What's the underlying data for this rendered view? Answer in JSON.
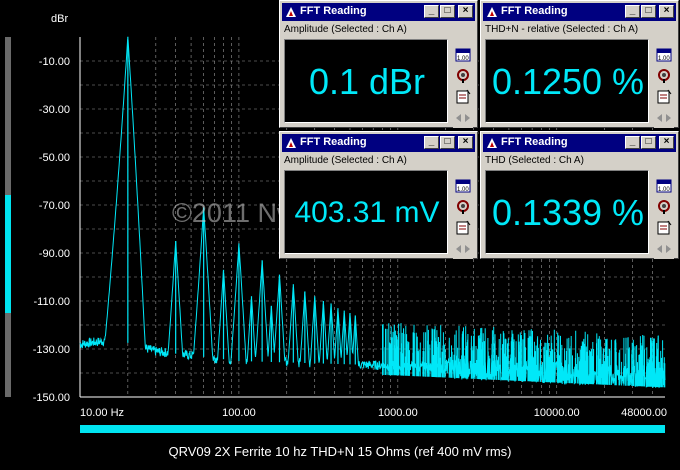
{
  "chart_data": {
    "type": "line",
    "ylabel": "dBr",
    "ylim": [
      -150,
      0
    ],
    "xscale": "log",
    "xlim": [
      10,
      48000
    ],
    "y_ticks": [
      "-10.00",
      "-30.00",
      "-50.00",
      "-70.00",
      "-90.00",
      "-110.00",
      "-130.00",
      "-150.00"
    ],
    "x_ticks": [
      "10.00 Hz",
      "100.00",
      "1000.00",
      "10000.00",
      "48000.00"
    ],
    "grid": true,
    "series": [
      {
        "color": "#00e8f8",
        "peaks": [
          {
            "x": 20,
            "y": 0.1
          },
          {
            "x": 40,
            "y": -85
          },
          {
            "x": 60,
            "y": -71
          },
          {
            "x": 80,
            "y": -97
          },
          {
            "x": 100,
            "y": -86
          },
          {
            "x": 120,
            "y": -108
          },
          {
            "x": 140,
            "y": -93
          },
          {
            "x": 160,
            "y": -112
          },
          {
            "x": 180,
            "y": -99
          },
          {
            "x": 220,
            "y": -103
          },
          {
            "x": 260,
            "y": -106
          },
          {
            "x": 300,
            "y": -108
          },
          {
            "x": 340,
            "y": -110
          },
          {
            "x": 380,
            "y": -111
          },
          {
            "x": 420,
            "y": -113
          },
          {
            "x": 460,
            "y": -114
          },
          {
            "x": 500,
            "y": -115
          },
          {
            "x": 540,
            "y": -116
          }
        ],
        "noise_floor": [
          {
            "x": 10,
            "y": -128
          },
          {
            "x": 17,
            "y": -126
          },
          {
            "x": 30,
            "y": -131
          },
          {
            "x": 100,
            "y": -135
          },
          {
            "x": 1000,
            "y": -137
          },
          {
            "x": 10000,
            "y": -140
          },
          {
            "x": 48000,
            "y": -142
          }
        ]
      }
    ]
  },
  "watermark": "©2011 NwAvGuy.com",
  "caption": "QRV09 2X Ferrite 10 hz THD+N 15 Ohms (ref 400 mV rms)",
  "windows": [
    {
      "title": "FFT Reading",
      "subtitle": "Amplitude (Selected : Ch A)",
      "value": "0.1 dBr"
    },
    {
      "title": "FFT Reading",
      "subtitle": "THD+N - relative (Selected : Ch A)",
      "value": "0.1250 %"
    },
    {
      "title": "FFT Reading",
      "subtitle": "Amplitude (Selected : Ch A)",
      "value": "403.31 mV"
    },
    {
      "title": "FFT Reading",
      "subtitle": "THD (Selected : Ch A)",
      "value": "0.1339 %"
    }
  ],
  "window_buttons": {
    "minimize": "_",
    "maximize": "□",
    "close": "×"
  },
  "side_buttons": [
    "meter-scale-icon",
    "settings-gear-icon",
    "notepad-icon",
    "arrows-icon"
  ],
  "colors": {
    "trace": "#00e8f8",
    "titlebar": "#000080",
    "window_face": "#d4d0c8",
    "grid": "#b0b0b0"
  }
}
